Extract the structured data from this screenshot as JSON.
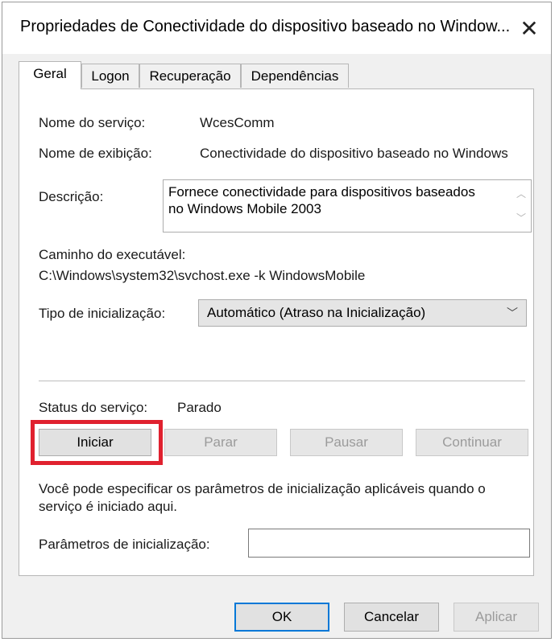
{
  "window": {
    "title": "Propriedades de Conectividade do dispositivo baseado no Window...",
    "close_glyph": "✕"
  },
  "tabs": [
    {
      "label": "Geral",
      "active": true
    },
    {
      "label": "Logon",
      "active": false
    },
    {
      "label": "Recuperação",
      "active": false
    },
    {
      "label": "Dependências",
      "active": false
    }
  ],
  "general": {
    "service_name_label": "Nome do serviço:",
    "service_name_value": "WcesComm",
    "display_name_label": "Nome de exibição:",
    "display_name_value": "Conectividade do dispositivo baseado no Windows",
    "description_label": "Descrição:",
    "description_value": "Fornece conectividade para dispositivos baseados no Windows Mobile 2003",
    "path_label": "Caminho do executável:",
    "path_value": "C:\\Windows\\system32\\svchost.exe -k WindowsMobile",
    "startup_type_label": "Tipo de inicialização:",
    "startup_type_value": "Automático (Atraso na Inicialização)",
    "status_label": "Status do serviço:",
    "status_value": "Parado",
    "start_button": "Iniciar",
    "stop_button": "Parar",
    "pause_button": "Pausar",
    "continue_button": "Continuar",
    "hint_text": "Você pode especificar os parâmetros de inicialização aplicáveis quando o serviço é iniciado aqui.",
    "params_label": "Parâmetros de inicialização:",
    "params_value": ""
  },
  "footer": {
    "ok": "OK",
    "cancel": "Cancelar",
    "apply": "Aplicar"
  },
  "colors": {
    "highlight": "#e0212f",
    "focus_border": "#0078d7"
  },
  "icons": {
    "close": "close-icon",
    "scroll_up": "chevron-up-icon",
    "scroll_down": "chevron-down-icon",
    "dropdown": "chevron-down-icon"
  }
}
